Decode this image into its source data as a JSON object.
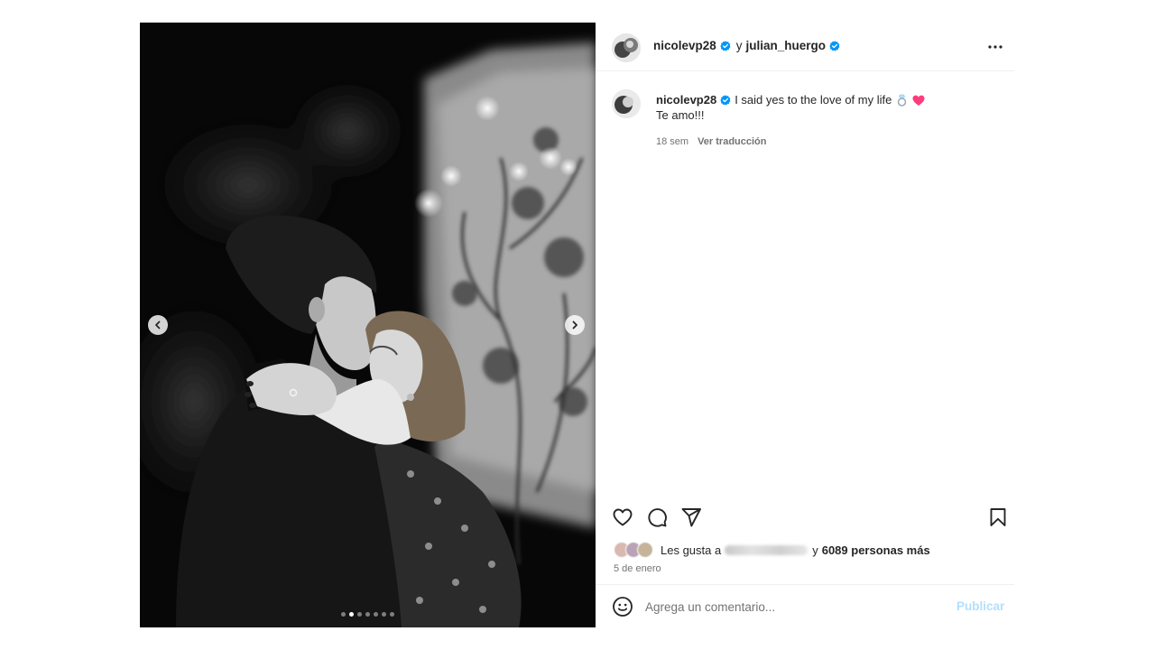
{
  "header": {
    "user1": "nicolevp28",
    "conjunction": "y",
    "user2": "julian_huergo",
    "more_icon": "more-horizontal-icon"
  },
  "caption": {
    "username": "nicolevp28",
    "text": "I said yes to the love of my life",
    "emojis": [
      "ring-icon",
      "pink-heart-icon"
    ],
    "line2": "Te amo!!!",
    "time": "18 sem",
    "translate": "Ver traducción"
  },
  "actions": {
    "icons": [
      "heart-icon",
      "comment-icon",
      "share-icon",
      "bookmark-icon"
    ]
  },
  "likes": {
    "prefix": "Les gusta a",
    "and": "y",
    "count_text": "6089 personas más"
  },
  "date": "5 de enero",
  "comment": {
    "placeholder": "Agrega un comentario...",
    "publish": "Publicar"
  },
  "carousel": {
    "total_slides": 7,
    "active_index": 1,
    "prev_icon": "chevron-left-icon",
    "next_icon": "chevron-right-icon"
  },
  "colors": {
    "verified": "#0095f6",
    "publish_disabled": "#b2dffc",
    "heart_emoji": "#ff3b7f",
    "secondary_text": "#737373"
  }
}
